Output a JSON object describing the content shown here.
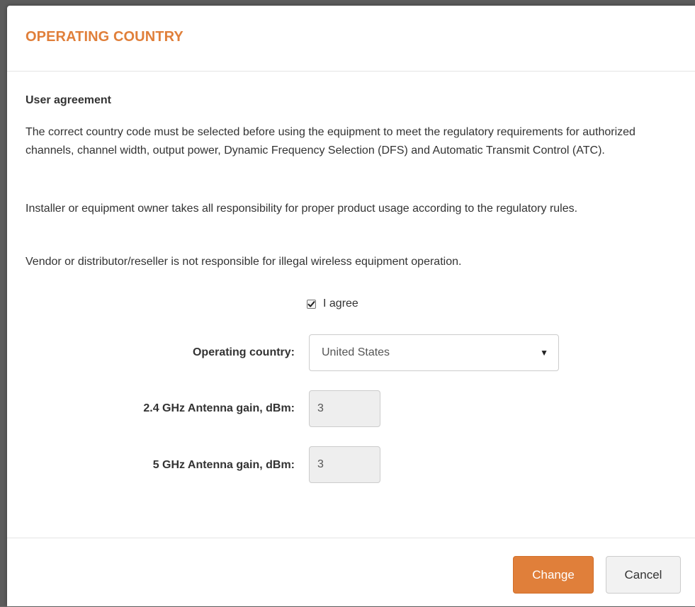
{
  "modal": {
    "title": "OPERATING COUNTRY"
  },
  "agreement": {
    "heading": "User agreement",
    "paragraphs": [
      "The correct country code must be selected before using the equipment to meet the regulatory requirements for authorized channels, channel width, output power, Dynamic Frequency Selection (DFS) and Automatic Transmit Control (ATC).",
      "Installer or equipment owner takes all responsibility for proper product usage according to the regulatory rules.",
      "Vendor or distributor/reseller is not responsible for illegal wireless equipment operation."
    ],
    "agree_label": "I agree",
    "agree_checked": true
  },
  "form": {
    "country_label": "Operating country:",
    "country_value": "United States",
    "gain24_label": "2.4 GHz Antenna gain, dBm:",
    "gain24_value": "3",
    "gain5_label": "5 GHz Antenna gain, dBm:",
    "gain5_value": "3"
  },
  "footer": {
    "change_label": "Change",
    "cancel_label": "Cancel"
  },
  "colors": {
    "accent": "#e07f3a",
    "text": "#333333"
  },
  "icons": {
    "checkbox": "checkmark-icon",
    "dropdown": "caret-down-icon"
  }
}
